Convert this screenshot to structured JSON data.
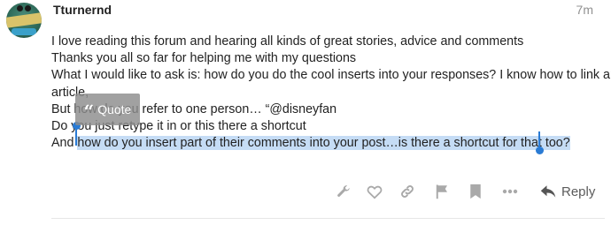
{
  "author": {
    "username": "Tturnernd",
    "time": "7m"
  },
  "post": {
    "line1": "I love reading this forum and hearing all kinds of great stories, advice and comments",
    "line2": "Thanks you all so far for helping me with my questions",
    "line3": "What I would like to ask is: how do you do the cool inserts into your responses? I know how to link an",
    "line4": "article,",
    "line5a": "But how do you refer to one person… “@disneyfan",
    "line6a": "Do you just retype it in or this there a shortcut",
    "line7_pre": "And ",
    "line7_sel": "how do you insert part of their comments into your post…is there a shortcut for that too?"
  },
  "quote_popup": {
    "label": "Quote"
  },
  "actions": {
    "reply_label": "Reply",
    "icons": [
      "wrench-icon",
      "heart-icon",
      "link-icon",
      "flag-icon",
      "bookmark-icon",
      "more-icon",
      "reply-icon"
    ]
  },
  "colors": {
    "selection": "#c5dcf5",
    "handle": "#2a7bd4",
    "muted": "#919191"
  }
}
